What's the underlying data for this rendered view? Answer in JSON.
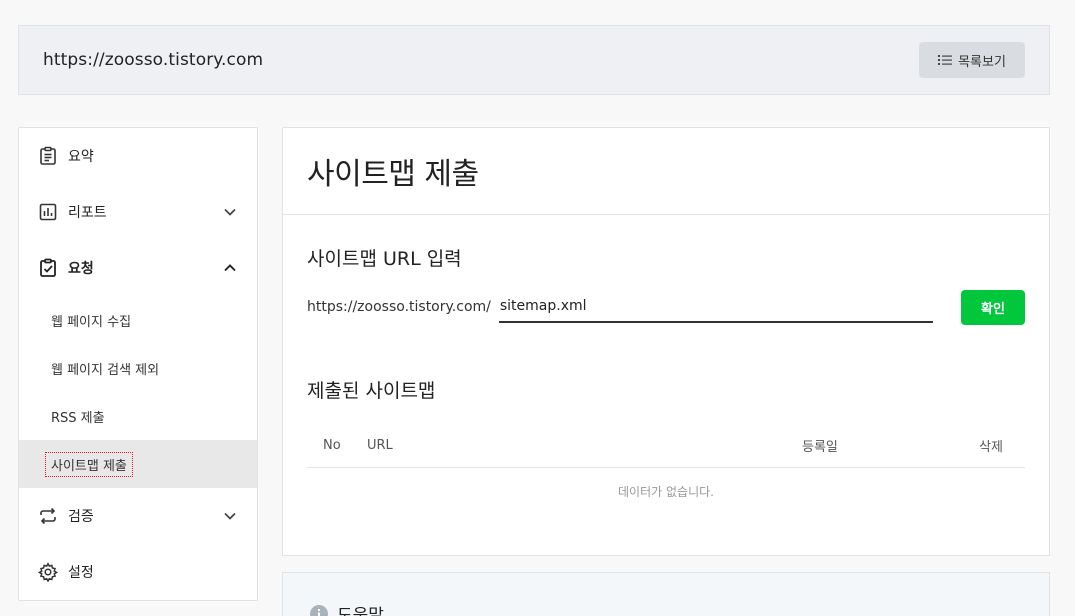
{
  "site": {
    "url": "https://zoosso.tistory.com",
    "list_button_label": "목록보기"
  },
  "sidebar": {
    "summary": "요약",
    "report": "리포트",
    "request": "요청",
    "request_items": [
      "웹 페이지 수집",
      "웹 페이지 검색 제외",
      "RSS 제출",
      "사이트맵 제출"
    ],
    "verify": "검증",
    "settings": "설정"
  },
  "main": {
    "title": "사이트맵 제출",
    "input_section_title": "사이트맵 URL 입력",
    "url_prefix": "https://zoosso.tistory.com/",
    "input_value": "sitemap.xml",
    "confirm_label": "확인",
    "submitted_title": "제출된 사이트맵",
    "columns": [
      "No",
      "URL",
      "등록일",
      "삭제"
    ],
    "empty_message": "데이터가 없습니다."
  },
  "help": {
    "title": "도움말"
  },
  "colors": {
    "accent": "#00c73c",
    "active_bg": "#e8e8e8"
  }
}
